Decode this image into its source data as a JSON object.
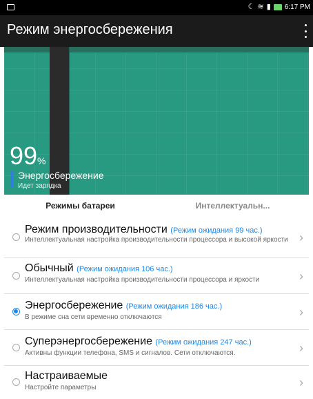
{
  "status_bar": {
    "time": "6:17 PM"
  },
  "app_bar": {
    "title": "Режим энергосбережения"
  },
  "hero": {
    "battery_percent": "99",
    "percent_sign": "%",
    "mode_label": "Энергосбережение",
    "charging_text": "Идет зарядка"
  },
  "tabs": [
    {
      "label": "Режимы батареи"
    },
    {
      "label": "Интеллектуальн..."
    }
  ],
  "modes": [
    {
      "title": "Режим производительности",
      "hint": "(Режим ожидания 99 час.)",
      "description": "Интеллектуальная настройка производительности процессора и высокой яркости",
      "selected": false
    },
    {
      "title": "Обычный",
      "hint": "(Режим ожидания 106 час.)",
      "description": "Интеллектуальная настройка производительности процессора и яркости",
      "selected": false
    },
    {
      "title": "Энергосбережение",
      "hint": "(Режим ожидания 186 час.)",
      "description": "В режиме сна сети временно отключаются",
      "selected": true
    },
    {
      "title": "Суперэнергосбережение",
      "hint": "(Режим ожидания 247 час.)",
      "description": "Активны функции телефона, SMS и сигналов. Сети отключаются.",
      "selected": false
    },
    {
      "title": "Настраиваемые",
      "hint": "",
      "description": "Настройте параметры",
      "selected": false
    }
  ],
  "colors": {
    "accent": "#1e88e5",
    "hero_bg": "#289a81"
  }
}
